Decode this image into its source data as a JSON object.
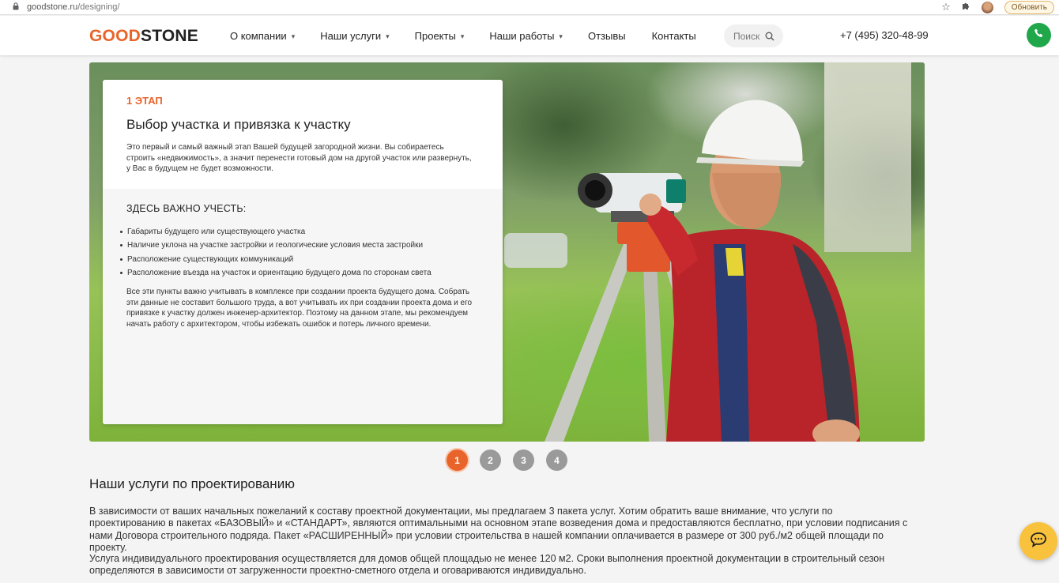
{
  "browser": {
    "url_host": "goodstone.ru",
    "url_path": "/designing/",
    "update_label": "Обновить"
  },
  "header": {
    "logo_part1": "GOOD",
    "logo_part2": "STONE",
    "nav": [
      {
        "label": "О компании",
        "has_dropdown": true
      },
      {
        "label": "Наши услуги",
        "has_dropdown": true
      },
      {
        "label": "Проекты",
        "has_dropdown": true
      },
      {
        "label": "Наши работы",
        "has_dropdown": true
      },
      {
        "label": "Отзывы",
        "has_dropdown": false
      },
      {
        "label": "Контакты",
        "has_dropdown": false
      }
    ],
    "search_placeholder": "Поиск",
    "phone": "+7 (495) 320-48-99"
  },
  "slide": {
    "step_label": "1 ЭТАП",
    "title": "Выбор участка и привязка к участку",
    "intro": "Это первый и самый важный этап Вашей будущей загородной жизни. Вы собираетесь строить «недвижимость», а значит перенести готовый дом на другой участок или развернуть, у Вас в будущем не будет возможности.",
    "subheading": "ЗДЕСЬ ВАЖНО УЧЕСТЬ:",
    "items": [
      "Габариты будущего или существующего участка",
      "Наличие уклона на участке застройки и геологические условия места застройки",
      "Расположение существующих коммуникаций",
      "Расположение въезда на участок и ориентацию будущего дома по сторонам света"
    ],
    "paragraph": "Все эти пункты важно учитывать в комплексе при создании проекта будущего дома. Собрать эти данные не составит большого труда, а вот учитывать их при создании проекта дома и его привязке к участку должен инженер-архитектор. Поэтому на данном этапе, мы рекомендуем начать работу с архитектором, чтобы избежать ошибок и потерь личного времени."
  },
  "pager": {
    "pages": [
      "1",
      "2",
      "3",
      "4"
    ],
    "active": "1"
  },
  "services": {
    "title": "Наши услуги по проектированию",
    "p1": "В зависимости от ваших начальных пожеланий к составу проектной документации, мы предлагаем 3 пакета услуг. Хотим обратить ваше внимание, что услуги по проектированию в пакетах «БАЗОВЫЙ» и «СТАНДАРТ», являются оптимальными на основном этапе возведения дома и предоставляются бесплатно, при условии подписания с нами Договора строительного подряда. Пакет «РАСШИРЕННЫЙ» при условии строительства в нашей компании оплачивается в размере от 300 руб./м2 общей площади по проекту.",
    "p2": "Услуга индивидуального проектирования осуществляется для домов общей площадью не менее 120 м2. Сроки выполнения проектной документации в строительный сезон определяются в зависимости от загруженности проектно-сметного отдела и оговариваются индивидуально."
  },
  "colors": {
    "accent": "#e8642a",
    "call_green": "#1fa74a",
    "chat_yellow": "#f9c23c",
    "pager_gray": "#9a9a9a"
  },
  "icons": {
    "lock": "lock-icon",
    "star": "star-icon",
    "extensions": "puzzle-icon",
    "search": "search-icon",
    "call": "phone-icon",
    "chat": "chat-icon"
  }
}
